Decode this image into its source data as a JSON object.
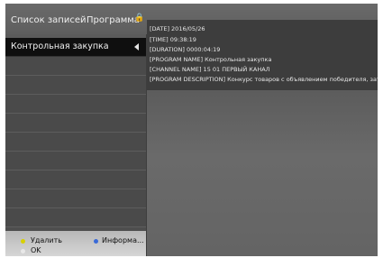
{
  "header": {
    "record_list_title": "Список записей",
    "program_title": "Программа"
  },
  "list": {
    "items": [
      {
        "label": "Контрольная закупка",
        "selected": true
      }
    ]
  },
  "info": {
    "lines": [
      "[DATE] 2016/05/26",
      "[TIME] 09:38:19",
      "[DURATION] 0000:04:19",
      "[PROGRAM NAME] Контрольная закупка",
      "[CHANNEL NAME] 15 01 ПЕРВЫЙ КАНАЛ",
      "[PROGRAM DESCRIPTION] Конкурс товаров с объявлением победителя, зат..."
    ]
  },
  "footer": {
    "delete_label": "Удалить",
    "info_label": "Информа...",
    "ok_label": "OK"
  },
  "colors": {
    "delete_dot": "#d8d000",
    "info_dot": "#3a6ad8",
    "ok_dot": "#e8e8e8"
  }
}
